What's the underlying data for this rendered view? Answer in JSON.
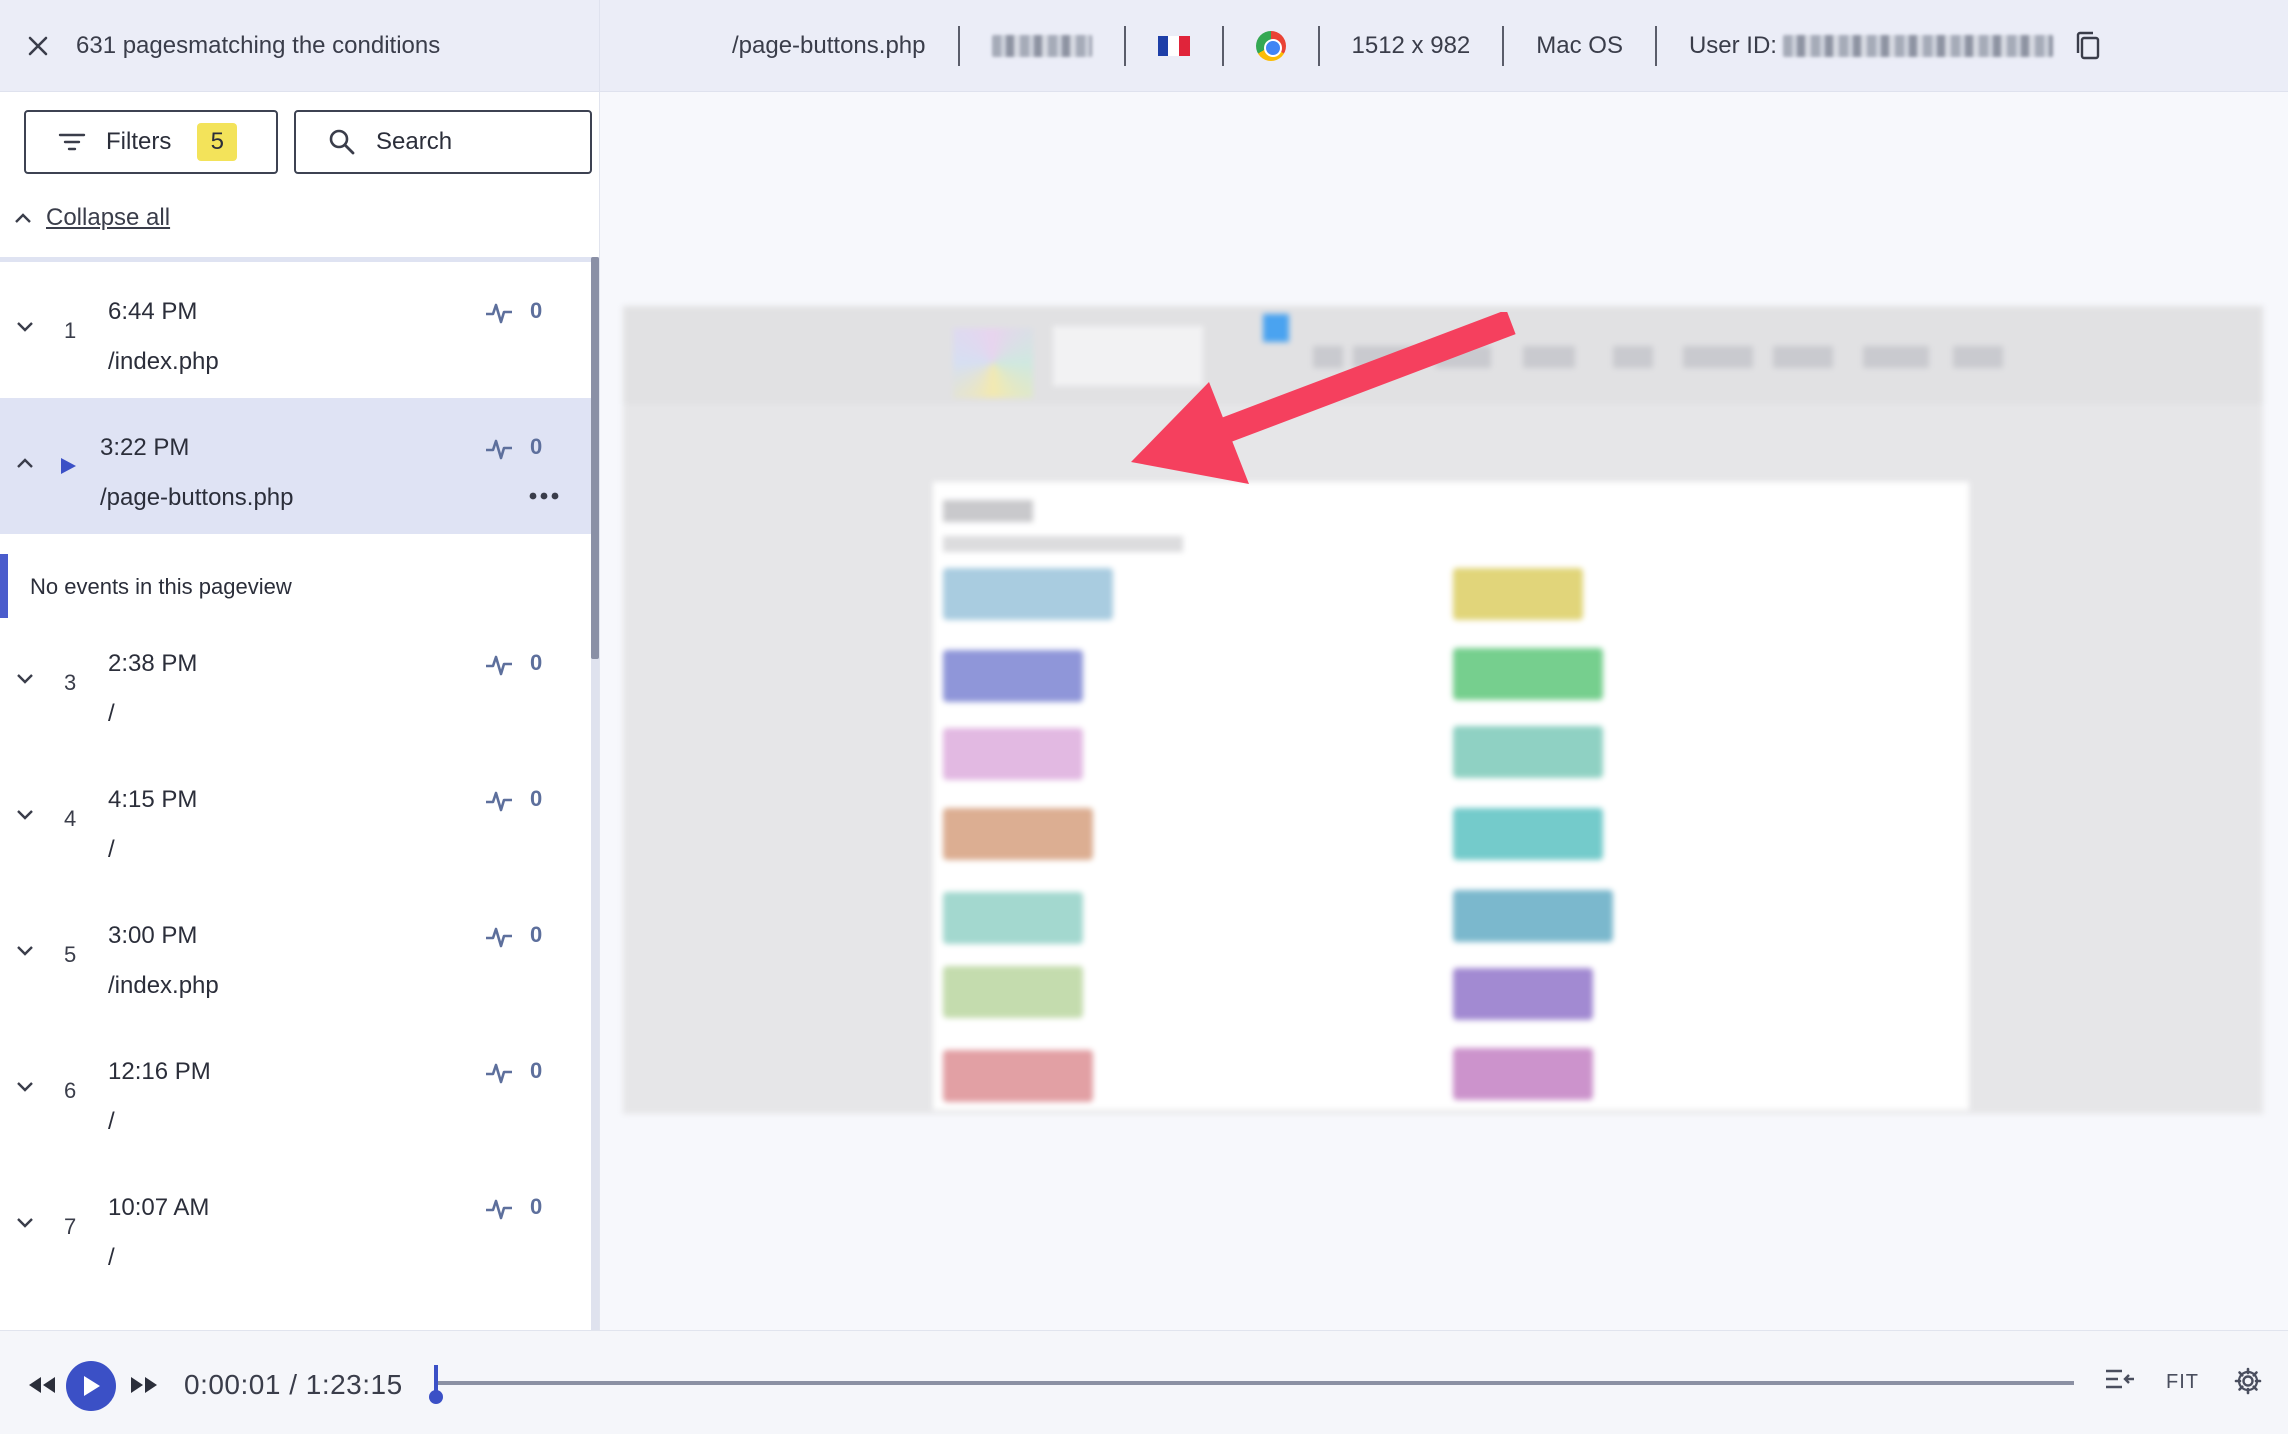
{
  "topbar": {
    "pages_count": "631 pagesmatching the conditions",
    "page": "/page-buttons.php",
    "resolution": "1512 x 982",
    "os": "Mac OS",
    "user_id_label": "User ID:"
  },
  "sidebar": {
    "filters_label": "Filters",
    "filters_count": "5",
    "search_label": "Search",
    "collapse_label": "Collapse all",
    "no_events_text": "No events in this pageview",
    "pageviews": [
      {
        "num": "1",
        "time": "6:44 PM",
        "path": "/index.php",
        "events": "0"
      },
      {
        "num": "",
        "time": "3:22 PM",
        "path": "/page-buttons.php",
        "events": "0"
      },
      {
        "num": "3",
        "time": "2:38 PM",
        "path": "/",
        "events": "0"
      },
      {
        "num": "4",
        "time": "4:15 PM",
        "path": "/",
        "events": "0"
      },
      {
        "num": "5",
        "time": "3:00 PM",
        "path": "/index.php",
        "events": "0"
      },
      {
        "num": "6",
        "time": "12:16 PM",
        "path": "/",
        "events": "0"
      },
      {
        "num": "7",
        "time": "10:07 AM",
        "path": "/",
        "events": "0"
      }
    ]
  },
  "player": {
    "timecode": "0:00:01 / 1:23:15",
    "fit_label": "FIT",
    "progress": 0.0002
  },
  "colors": {
    "accent": "#3b50c6",
    "badge": "#f3e35a",
    "annotation_arrow": "#f5405e"
  }
}
